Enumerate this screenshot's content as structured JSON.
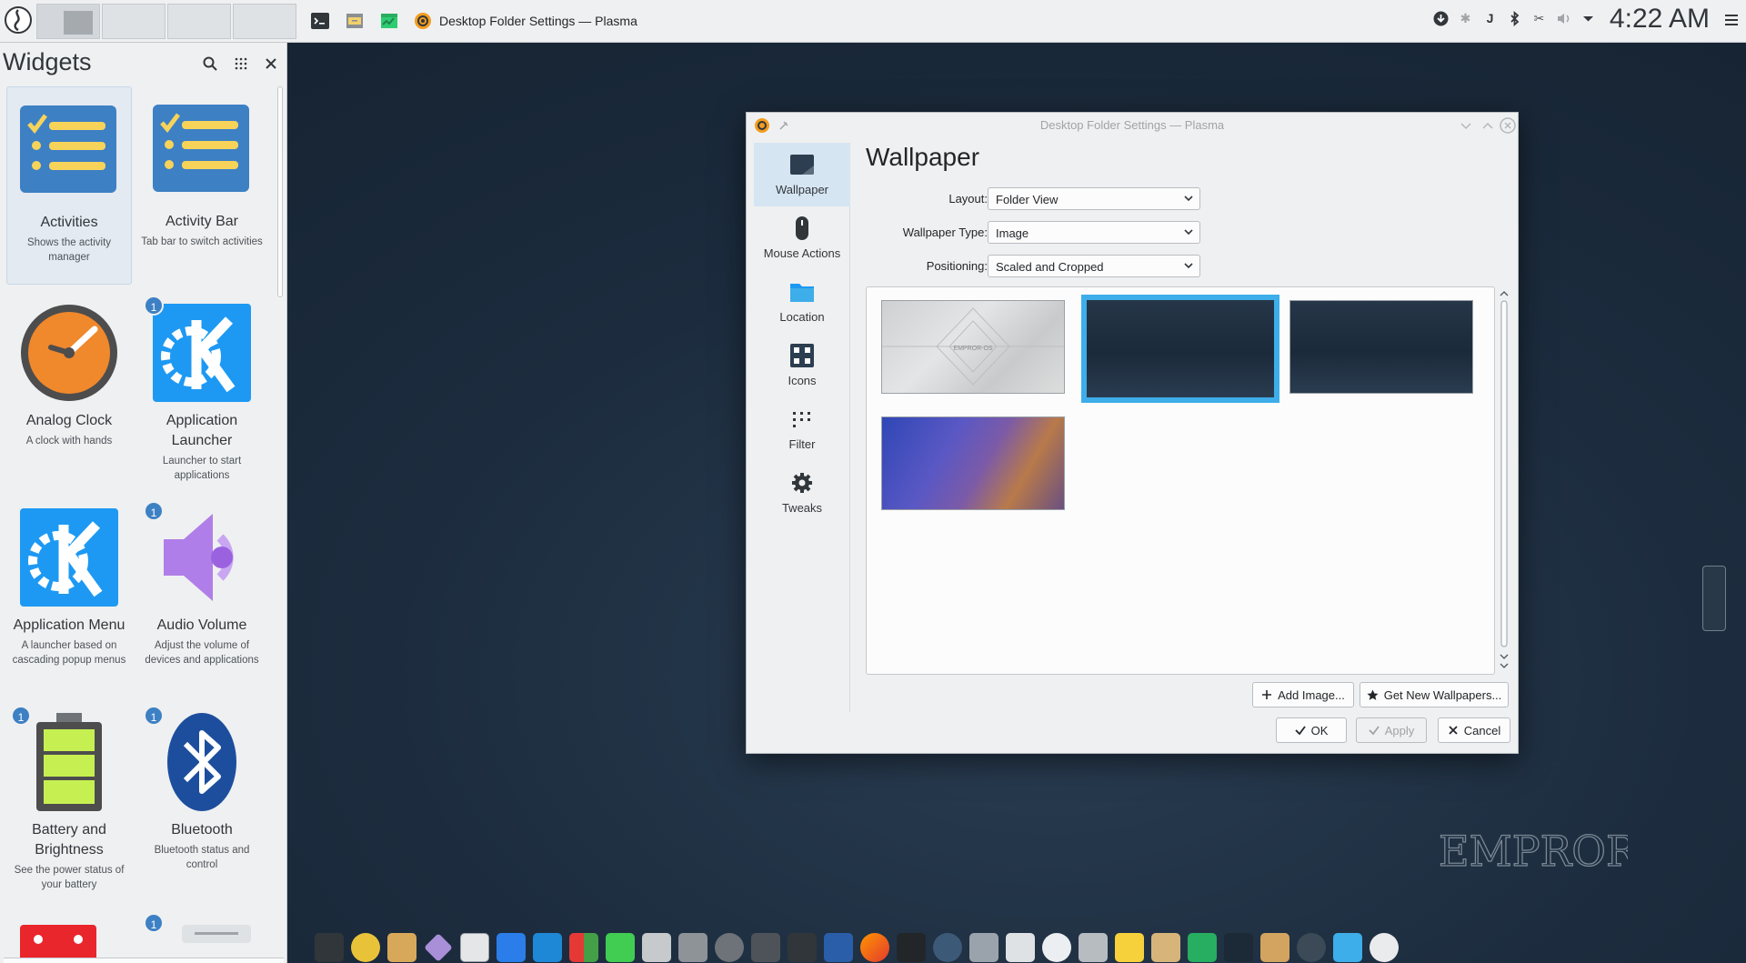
{
  "panel": {
    "launchers": [
      "terminal-icon",
      "file-manager-icon",
      "system-monitor-icon"
    ],
    "task_title": "Desktop Folder Settings — Plasma",
    "clock": "4:22 AM",
    "tray": [
      "download-icon",
      "bluetooth-icon",
      "j-icon",
      "bluetooth-icon",
      "scissors-icon",
      "volume-icon",
      "expand-tray-icon"
    ]
  },
  "widgets_panel": {
    "title": "Widgets",
    "items": [
      {
        "name": "Activities",
        "desc": "Shows the activity manager",
        "icon": "checklist-icon",
        "badge": ""
      },
      {
        "name": "Activity Bar",
        "desc": "Tab bar to switch activities",
        "icon": "checklist-icon",
        "badge": ""
      },
      {
        "name": "Analog Clock",
        "desc": "A clock with hands",
        "icon": "clock-icon",
        "badge": ""
      },
      {
        "name": "Application Launcher",
        "desc": "Launcher to start applications",
        "icon": "kde-icon",
        "badge": "1"
      },
      {
        "name": "Application Menu",
        "desc": "A launcher based on cascading popup menus",
        "icon": "kde-icon",
        "badge": ""
      },
      {
        "name": "Audio Volume",
        "desc": "Adjust the volume of devices and applications",
        "icon": "speaker-icon",
        "badge": "1"
      },
      {
        "name": "Battery and Brightness",
        "desc": "See the power status of your battery",
        "icon": "battery-icon",
        "badge": "1"
      },
      {
        "name": "Bluetooth",
        "desc": "Bluetooth status and control",
        "icon": "bluetooth-icon",
        "badge": "1"
      }
    ],
    "partial_badge": "1"
  },
  "dialog": {
    "title": "Desktop Folder Settings — Plasma",
    "categories": [
      {
        "label": "Wallpaper",
        "icon": "wallpaper-icon"
      },
      {
        "label": "Mouse Actions",
        "icon": "mouse-icon"
      },
      {
        "label": "Location",
        "icon": "folder-icon"
      },
      {
        "label": "Icons",
        "icon": "icons-grid-icon"
      },
      {
        "label": "Filter",
        "icon": "filter-icon"
      },
      {
        "label": "Tweaks",
        "icon": "gear-icon"
      }
    ],
    "heading": "Wallpaper",
    "layout_label": "Layout:",
    "layout_value": "Folder View",
    "type_label": "Wallpaper Type:",
    "type_value": "Image",
    "positioning_label": "Positioning:",
    "positioning_value": "Scaled and Cropped",
    "thumbnail_text": "EMPROR-OS",
    "add_image": "Add Image...",
    "get_new": "Get New Wallpapers...",
    "ok": "OK",
    "apply": "Apply",
    "cancel": "Cancel"
  },
  "desktop": {
    "brand": "EMPROR-OS"
  },
  "colors": {
    "accent": "#3daee9",
    "badge": "#3d80c4"
  }
}
